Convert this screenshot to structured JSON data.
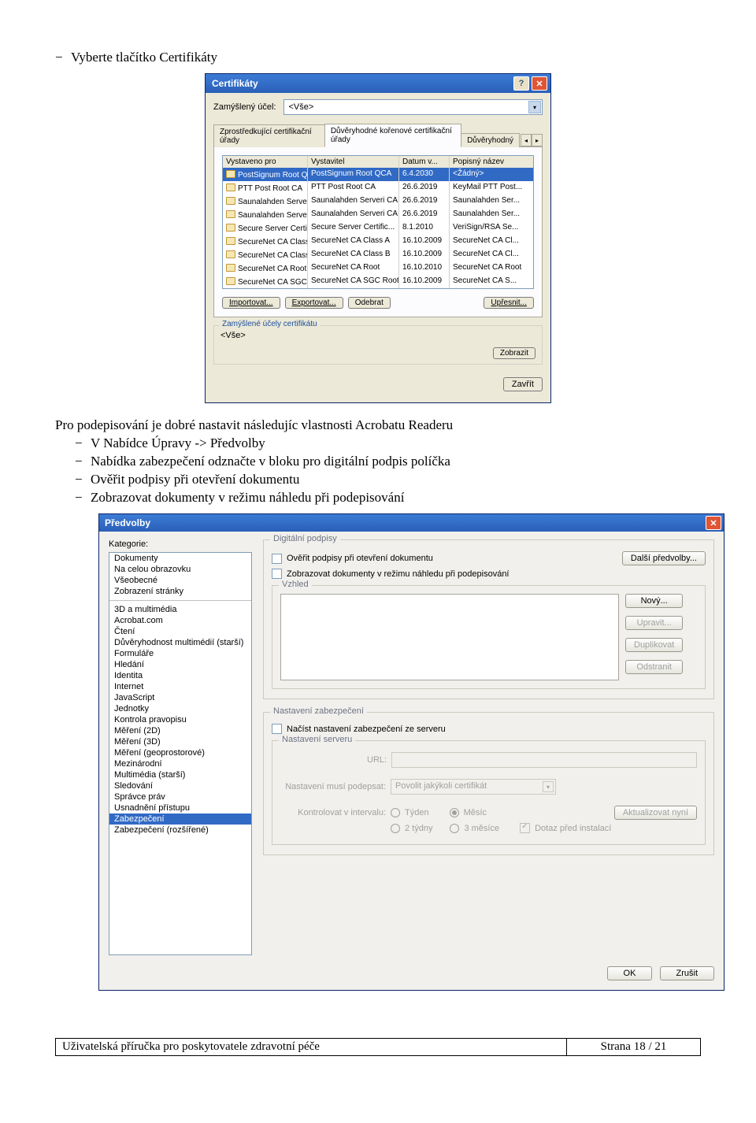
{
  "page": {
    "bullet1": "Vyberte tlačítko Certifikáty",
    "para1": "Pro podepisování je dobré nastavit následujíc vlastnosti Acrobatu Readeru",
    "b2": "V Nabídce Úpravy -> Předvolby",
    "b3": "Nabídka zabezpečení odznačte v bloku pro digitální podpis políčka",
    "b4": "Ověřit podpisy při otevření dokumentu",
    "b5": "Zobrazovat dokumenty v režimu náhledu při podepisování"
  },
  "cert": {
    "title": "Certifikáty",
    "purpose_label": "Zamýšlený účel:",
    "purpose_value": "<Vše>",
    "tabs": [
      "Zprostředkující certifikační úřady",
      "Důvěryhodné kořenové certifikační úřady",
      "Důvěryhodný"
    ],
    "cols": [
      "Vystaveno pro",
      "Vystavitel",
      "Datum v...",
      "Popisný název"
    ],
    "rows": [
      {
        "a": "PostSignum Root QCA",
        "b": "PostSignum Root QCA",
        "c": "6.4.2030",
        "d": "<Žádný>",
        "sel": true
      },
      {
        "a": "PTT Post Root CA",
        "b": "PTT Post Root CA",
        "c": "26.6.2019",
        "d": "KeyMail PTT Post..."
      },
      {
        "a": "Saunalahden Serve...",
        "b": "Saunalahden Serveri CA",
        "c": "26.6.2019",
        "d": "Saunalahden Ser..."
      },
      {
        "a": "Saunalahden Serve...",
        "b": "Saunalahden Serveri CA",
        "c": "26.6.2019",
        "d": "Saunalahden Ser..."
      },
      {
        "a": "Secure Server Certi...",
        "b": "Secure Server Certific...",
        "c": "8.1.2010",
        "d": "VeriSign/RSA Se..."
      },
      {
        "a": "SecureNet CA Class A",
        "b": "SecureNet CA Class A",
        "c": "16.10.2009",
        "d": "SecureNet CA Cl..."
      },
      {
        "a": "SecureNet CA Class B",
        "b": "SecureNet CA Class B",
        "c": "16.10.2009",
        "d": "SecureNet CA Cl..."
      },
      {
        "a": "SecureNet CA Root",
        "b": "SecureNet CA Root",
        "c": "16.10.2010",
        "d": "SecureNet CA Root"
      },
      {
        "a": "SecureNet CA SGC ...",
        "b": "SecureNet CA SGC Root",
        "c": "16.10.2009",
        "d": "SecureNet CA S..."
      }
    ],
    "btn_import": "Importovat...",
    "btn_export": "Exportovat...",
    "btn_remove": "Odebrat",
    "btn_detail": "Upřesnit...",
    "fs_legend": "Zamýšlené účely certifikátu",
    "fs_value": "<Vše>",
    "btn_show": "Zobrazit",
    "btn_close": "Zavřít"
  },
  "pref": {
    "title": "Předvolby",
    "cat_label": "Kategorie:",
    "cats_top": [
      "Dokumenty",
      "Na celou obrazovku",
      "Všeobecné",
      "Zobrazení stránky"
    ],
    "cats_bottom": [
      "3D a multimédia",
      "Acrobat.com",
      "Čtení",
      "Důvěryhodnost multimédií (starší)",
      "Formuláře",
      "Hledání",
      "Identita",
      "Internet",
      "JavaScript",
      "Jednotky",
      "Kontrola pravopisu",
      "Měření (2D)",
      "Měření (3D)",
      "Měření (geoprostorové)",
      "Mezinárodní",
      "Multimédia (starší)",
      "Sledování",
      "Správce práv",
      "Usnadnění přístupu",
      "Zabezpečení",
      "Zabezpečení (rozšířené)"
    ],
    "selected_cat": "Zabezpečení",
    "fs_sig": "Digitální podpisy",
    "chk1": "Ověřit podpisy při otevření dokumentu",
    "chk2": "Zobrazovat dokumenty v režimu náhledu při podepisování",
    "btn_more": "Další předvolby...",
    "fs_vzhled": "Vzhled",
    "btn_new": "Nový...",
    "btn_edit": "Upravit...",
    "btn_dup": "Duplikovat",
    "btn_del": "Odstranit",
    "fs_zab": "Nastavení zabezpečení",
    "chk_zab": "Načíst nastavení zabezpečení ze serveru",
    "fs_server": "Nastavení serveru",
    "lbl_url": "URL:",
    "lbl_sign": "Nastavení musí podepsat:",
    "sel_sign": "Povolit jakýkoli certifikát",
    "lbl_int": "Kontrolovat v intervalu:",
    "r1": "Týden",
    "r2": "Měsíc",
    "r3": "2 týdny",
    "r4": "3 měsíce",
    "chk_ask": "Dotaz před instalací",
    "btn_upd": "Aktualizovat nyní",
    "btn_ok": "OK",
    "btn_cancel": "Zrušit"
  },
  "footer": {
    "left": "Uživatelská příručka pro poskytovatele zdravotní péče",
    "right": "Strana 18 / 21"
  }
}
